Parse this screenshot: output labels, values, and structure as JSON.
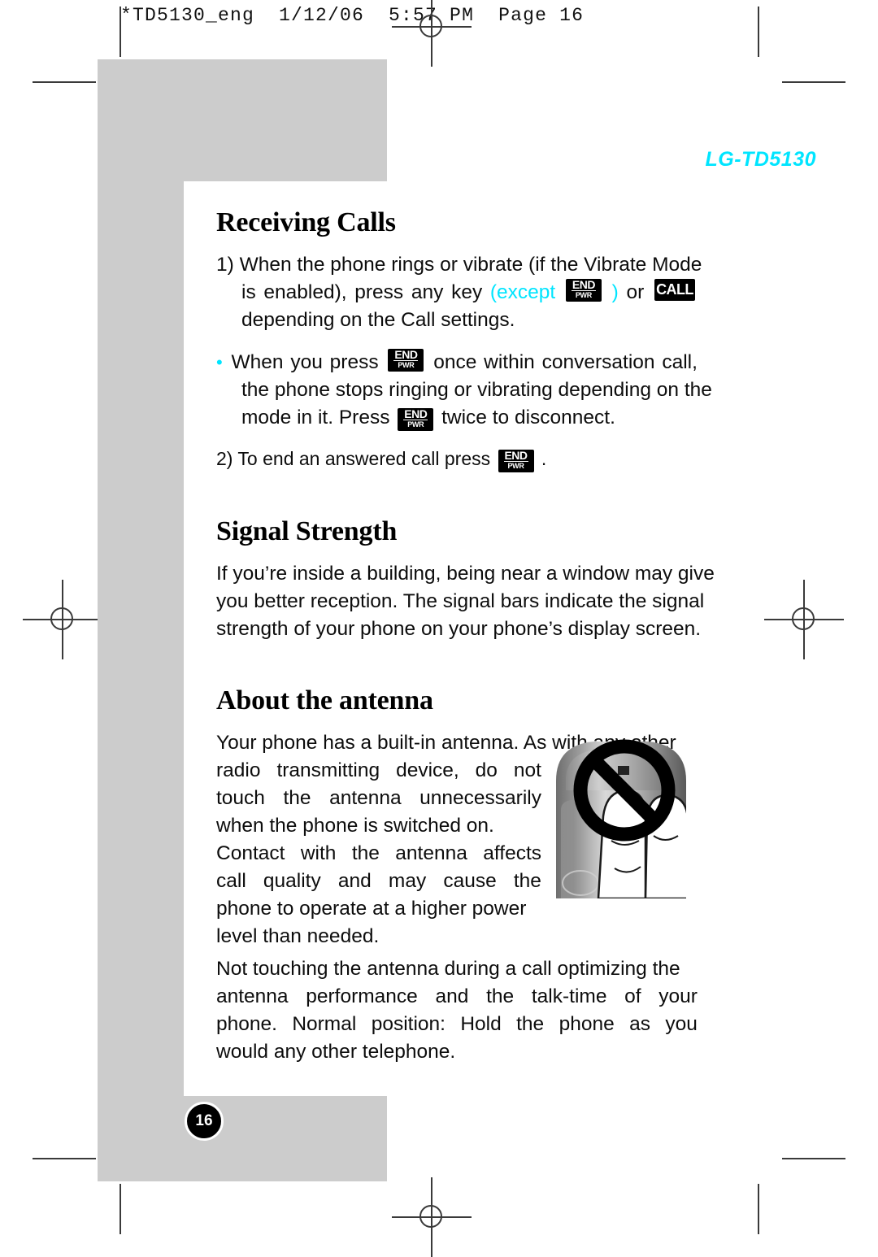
{
  "printer_header": "*TD5130_eng  1/12/06  5:57 PM  Page 16",
  "brand": "LG-TD5130",
  "colors": {
    "accent_cyan": "#00e5ff",
    "grey_block": "#cccccc",
    "text": "#0d0d0d"
  },
  "page_number": "16",
  "sections": [
    {
      "id": "receiving-calls",
      "title": "Receiving Calls",
      "paragraphs": [
        {
          "id": "rc-item-1",
          "lines": [
            "1) When the phone rings or vibrate (if the Vibrate Mode",
            "is enabled), press any key (except [END] ) or [CALL]",
            "depending on the Call settings."
          ]
        },
        {
          "id": "rc-bullet",
          "lines": [
            "• When you press [END] once within conversation call,",
            "the phone stops ringing or vibrating depending on the",
            "mode in it.  Press [END] twice to disconnect."
          ]
        },
        {
          "id": "rc-item-2",
          "lines": [
            "2) To end an answered call press [END] ."
          ]
        }
      ]
    },
    {
      "id": "signal-strength",
      "title": "Signal Strength",
      "paragraphs": [
        {
          "id": "ss-p1",
          "lines": [
            "If you’re inside a building, being near a window may give",
            "you better reception. The signal bars indicate the signal",
            "strength of your phone on your phone’s display screen."
          ]
        }
      ]
    },
    {
      "id": "about-the-antenna",
      "title": "About the antenna",
      "paragraphs": [
        {
          "id": "ata-p1",
          "lines": [
            "Your phone has a built-in antenna. As with any other",
            "radio transmitting device, do not",
            "touch the antenna unnecessarily",
            "when the phone is switched on.",
            "Contact with the antenna affects",
            "call quality and may cause the",
            "phone to operate at a higher power",
            "level than needed."
          ]
        },
        {
          "id": "ata-p2",
          "lines": [
            "Not touching the antenna during a call optimizing the",
            "antenna performance and the talk-time of your",
            "phone. Normal position: Hold the phone as you",
            "would any other telephone."
          ]
        }
      ]
    }
  ],
  "text_fragments": {
    "rc1_l1": "1) When the phone rings or vibrate (if the Vibrate Mode",
    "rc1_l2_a": "is",
    "rc1_l2_b": "enabled),",
    "rc1_l2_c": "press",
    "rc1_l2_d": "any",
    "rc1_l2_e": "key",
    "rc1_l2_except": "(except",
    "rc1_l2_closeparen": ")",
    "rc1_l2_or": "or",
    "rc1_l3": "depending on the Call settings.",
    "rcb_l1_a": "When",
    "rcb_l1_b": "you",
    "rcb_l1_c": "press",
    "rcb_l1_d": "once",
    "rcb_l1_e": "within",
    "rcb_l1_f": "conversation",
    "rcb_l1_g": "call,",
    "rcb_l2": "the phone stops ringing or vibrating depending on the",
    "rcb_l3_a": "mode in it.  Press",
    "rcb_l3_b": "twice to disconnect.",
    "rc2_a": "2) To end an answered call press",
    "rc2_b": ".",
    "ss_l1": "If you’re inside a building, being near a window may give",
    "ss_l2": "you better reception. The signal bars indicate the signal",
    "ss_l3": "strength of your phone on your phone’s display screen.",
    "ata_l1": "Your phone has a built-in antenna. As with any other",
    "ata_l2_a": "radio",
    "ata_l2_b": "transmitting",
    "ata_l2_c": "device,",
    "ata_l2_d": "do",
    "ata_l2_e": "not",
    "ata_l3_a": "touch",
    "ata_l3_b": "the",
    "ata_l3_c": "antenna",
    "ata_l3_d": "unnecessarily",
    "ata_l4": "when the phone is switched on.",
    "ata_l5_a": "Contact",
    "ata_l5_b": "with",
    "ata_l5_c": "the",
    "ata_l5_d": "antenna",
    "ata_l5_e": "affects",
    "ata_l6_a": "call",
    "ata_l6_b": "quality",
    "ata_l6_c": "and",
    "ata_l6_d": "may",
    "ata_l6_e": "cause",
    "ata_l6_f": "the",
    "ata_l7": "phone to operate at a higher power",
    "ata_l8": "level than needed.",
    "ata2_l1": "Not touching the antenna during a call optimizing the",
    "ata2_l2_a": "antenna",
    "ata2_l2_b": "performance",
    "ata2_l2_c": "and",
    "ata2_l2_d": "the",
    "ata2_l2_e": "talk-time",
    "ata2_l2_f": "of",
    "ata2_l2_g": "your",
    "ata2_l3_a": "phone.",
    "ata2_l3_b": "Normal",
    "ata2_l3_c": "position:",
    "ata2_l3_d": "Hold",
    "ata2_l3_e": "the",
    "ata2_l3_f": "phone",
    "ata2_l3_g": "as",
    "ata2_l3_h": "you",
    "ata2_l4": "would any other telephone."
  },
  "key_icons": {
    "end_top": "END",
    "end_bottom": "PWR",
    "call": "CALL"
  }
}
